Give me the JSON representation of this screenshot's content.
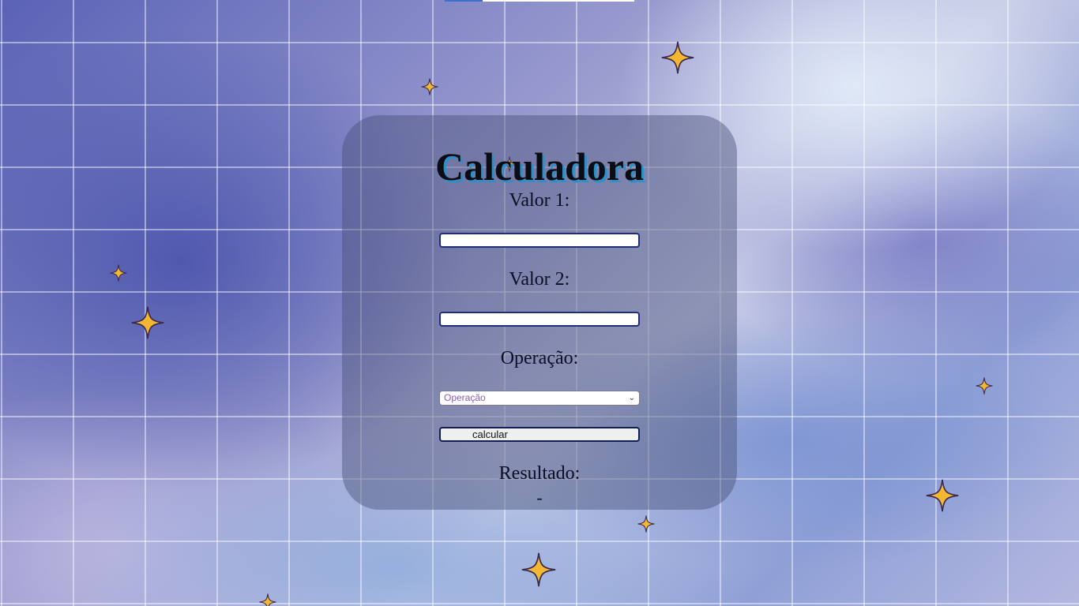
{
  "calculator": {
    "title": "Calculadora",
    "value1_label": "Valor 1:",
    "value1_input": "",
    "value2_label": "Valor 2:",
    "value2_input": "",
    "operation_label": "Operação:",
    "operation_select_value": "Operação",
    "calculate_button": "calcular",
    "result_label": "Resultado:",
    "result_value": "-"
  },
  "icons": {
    "decoration": "sparkle-star-icon",
    "select_arrow": "chevron-down-icon"
  },
  "colors": {
    "star_fill": "#f5b731",
    "star_stroke": "#3a2a50",
    "title_shadow": "#2d8fc8",
    "input_border": "#1d2f7a",
    "select_text": "#8a5fb0"
  }
}
